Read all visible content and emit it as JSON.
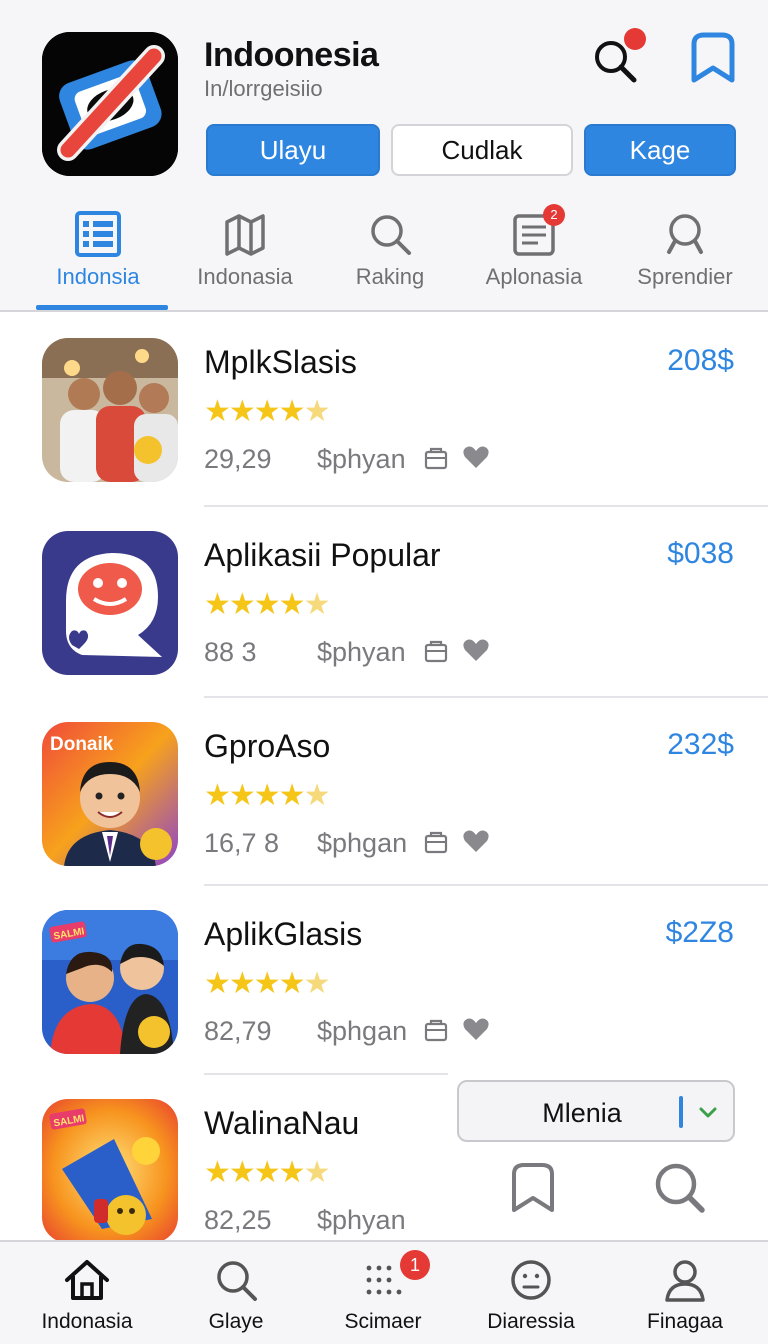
{
  "header": {
    "title": "Indoonesia",
    "subtitle": "In/lorrgeisiio",
    "buttons": [
      "Ulayu",
      "Cudlak",
      "Kage"
    ],
    "logo_icon": "app-logo-icon",
    "search_icon": "search-icon",
    "bookmark_icon": "bookmark-icon"
  },
  "tabs": [
    {
      "label": "Indonsia",
      "icon": "list-icon",
      "active": true
    },
    {
      "label": "Indonasia",
      "icon": "map-icon"
    },
    {
      "label": "Raking",
      "icon": "search-icon"
    },
    {
      "label": "Aplonasia",
      "icon": "document-icon",
      "badge": "2"
    },
    {
      "label": "Sprendier",
      "icon": "search-icon"
    }
  ],
  "apps": [
    {
      "name": "MplkSlasis",
      "price": "208$",
      "rating": 4.5,
      "count": "29,29",
      "tag": "$phyan"
    },
    {
      "name": "Aplikasii Popular",
      "price": "$038",
      "rating": 4.5,
      "count": "88 3",
      "tag": "$phyan"
    },
    {
      "name": "GproAso",
      "price": "232$",
      "rating": 4.5,
      "count": "16,7 8",
      "tag": "$phgan",
      "thumb_text": "Donaik"
    },
    {
      "name": "AplikGlasis",
      "price": "$2Z8",
      "rating": 4.5,
      "count": "82,79",
      "tag": "$phgan",
      "thumb_text": "SALMI"
    },
    {
      "name": "WalinaNau",
      "price": "",
      "rating": 4.5,
      "count": "82,25",
      "tag": "$phyan",
      "thumb_text": "SALMI"
    }
  ],
  "float_menu": {
    "label": "Mlenia"
  },
  "bottom_nav": [
    {
      "label": "Indonasia",
      "icon": "home-icon"
    },
    {
      "label": "Glaye",
      "icon": "search-icon"
    },
    {
      "label": "Scimaer",
      "icon": "grid-icon",
      "badge": "1"
    },
    {
      "label": "Diaressia",
      "icon": "face-icon"
    },
    {
      "label": "Finagaa",
      "icon": "person-icon"
    }
  ],
  "colors": {
    "accent": "#2f86e0",
    "star": "#f5c518",
    "badge": "#e53935"
  }
}
